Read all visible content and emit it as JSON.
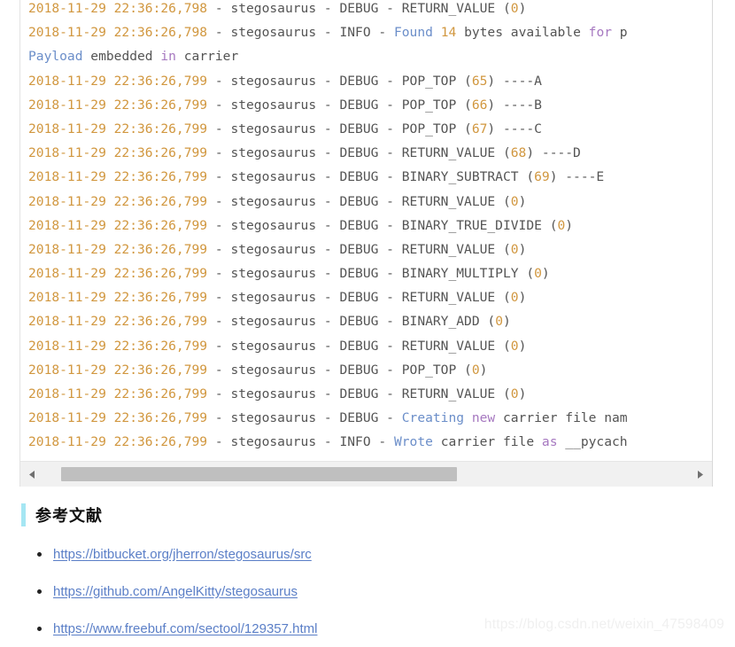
{
  "code_block": {
    "language": "log",
    "lines": [
      [
        {
          "t": "2018-11-29 22:36:26,798",
          "c": "time"
        },
        {
          "t": " - stegosaurus - DEBUG - RETURN_VALUE ",
          "c": "plain"
        },
        {
          "t": "(",
          "c": "plain"
        },
        {
          "t": "0",
          "c": "num"
        },
        {
          "t": ")",
          "c": "plain"
        }
      ],
      [
        {
          "t": "2018-11-29 22:36:26,798",
          "c": "time"
        },
        {
          "t": " - stegosaurus - INFO - ",
          "c": "plain"
        },
        {
          "t": "Found",
          "c": "kw"
        },
        {
          "t": " ",
          "c": "plain"
        },
        {
          "t": "14",
          "c": "num"
        },
        {
          "t": " bytes available ",
          "c": "plain"
        },
        {
          "t": "for",
          "c": "op"
        },
        {
          "t": " p",
          "c": "plain"
        }
      ],
      [
        {
          "t": "Payload",
          "c": "kw"
        },
        {
          "t": " embedded ",
          "c": "plain"
        },
        {
          "t": "in",
          "c": "op"
        },
        {
          "t": " carrier",
          "c": "plain"
        }
      ],
      [
        {
          "t": "2018-11-29 22:36:26,799",
          "c": "time"
        },
        {
          "t": " - stegosaurus - DEBUG - POP_TOP ",
          "c": "plain"
        },
        {
          "t": "(",
          "c": "plain"
        },
        {
          "t": "65",
          "c": "num"
        },
        {
          "t": ") ----A",
          "c": "plain"
        }
      ],
      [
        {
          "t": "2018-11-29 22:36:26,799",
          "c": "time"
        },
        {
          "t": " - stegosaurus - DEBUG - POP_TOP ",
          "c": "plain"
        },
        {
          "t": "(",
          "c": "plain"
        },
        {
          "t": "66",
          "c": "num"
        },
        {
          "t": ") ----B",
          "c": "plain"
        }
      ],
      [
        {
          "t": "2018-11-29 22:36:26,799",
          "c": "time"
        },
        {
          "t": " - stegosaurus - DEBUG - POP_TOP ",
          "c": "plain"
        },
        {
          "t": "(",
          "c": "plain"
        },
        {
          "t": "67",
          "c": "num"
        },
        {
          "t": ") ----C",
          "c": "plain"
        }
      ],
      [
        {
          "t": "2018-11-29 22:36:26,799",
          "c": "time"
        },
        {
          "t": " - stegosaurus - DEBUG - RETURN_VALUE ",
          "c": "plain"
        },
        {
          "t": "(",
          "c": "plain"
        },
        {
          "t": "68",
          "c": "num"
        },
        {
          "t": ") ----D",
          "c": "plain"
        }
      ],
      [
        {
          "t": "2018-11-29 22:36:26,799",
          "c": "time"
        },
        {
          "t": " - stegosaurus - DEBUG - BINARY_SUBTRACT ",
          "c": "plain"
        },
        {
          "t": "(",
          "c": "plain"
        },
        {
          "t": "69",
          "c": "num"
        },
        {
          "t": ") ----E",
          "c": "plain"
        }
      ],
      [
        {
          "t": "2018-11-29 22:36:26,799",
          "c": "time"
        },
        {
          "t": " - stegosaurus - DEBUG - RETURN_VALUE ",
          "c": "plain"
        },
        {
          "t": "(",
          "c": "plain"
        },
        {
          "t": "0",
          "c": "num"
        },
        {
          "t": ")",
          "c": "plain"
        }
      ],
      [
        {
          "t": "2018-11-29 22:36:26,799",
          "c": "time"
        },
        {
          "t": " - stegosaurus - DEBUG - BINARY_TRUE_DIVIDE ",
          "c": "plain"
        },
        {
          "t": "(",
          "c": "plain"
        },
        {
          "t": "0",
          "c": "num"
        },
        {
          "t": ")",
          "c": "plain"
        }
      ],
      [
        {
          "t": "2018-11-29 22:36:26,799",
          "c": "time"
        },
        {
          "t": " - stegosaurus - DEBUG - RETURN_VALUE ",
          "c": "plain"
        },
        {
          "t": "(",
          "c": "plain"
        },
        {
          "t": "0",
          "c": "num"
        },
        {
          "t": ")",
          "c": "plain"
        }
      ],
      [
        {
          "t": "2018-11-29 22:36:26,799",
          "c": "time"
        },
        {
          "t": " - stegosaurus - DEBUG - BINARY_MULTIPLY ",
          "c": "plain"
        },
        {
          "t": "(",
          "c": "plain"
        },
        {
          "t": "0",
          "c": "num"
        },
        {
          "t": ")",
          "c": "plain"
        }
      ],
      [
        {
          "t": "2018-11-29 22:36:26,799",
          "c": "time"
        },
        {
          "t": " - stegosaurus - DEBUG - RETURN_VALUE ",
          "c": "plain"
        },
        {
          "t": "(",
          "c": "plain"
        },
        {
          "t": "0",
          "c": "num"
        },
        {
          "t": ")",
          "c": "plain"
        }
      ],
      [
        {
          "t": "2018-11-29 22:36:26,799",
          "c": "time"
        },
        {
          "t": " - stegosaurus - DEBUG - BINARY_ADD ",
          "c": "plain"
        },
        {
          "t": "(",
          "c": "plain"
        },
        {
          "t": "0",
          "c": "num"
        },
        {
          "t": ")",
          "c": "plain"
        }
      ],
      [
        {
          "t": "2018-11-29 22:36:26,799",
          "c": "time"
        },
        {
          "t": " - stegosaurus - DEBUG - RETURN_VALUE ",
          "c": "plain"
        },
        {
          "t": "(",
          "c": "plain"
        },
        {
          "t": "0",
          "c": "num"
        },
        {
          "t": ")",
          "c": "plain"
        }
      ],
      [
        {
          "t": "2018-11-29 22:36:26,799",
          "c": "time"
        },
        {
          "t": " - stegosaurus - DEBUG - POP_TOP ",
          "c": "plain"
        },
        {
          "t": "(",
          "c": "plain"
        },
        {
          "t": "0",
          "c": "num"
        },
        {
          "t": ")",
          "c": "plain"
        }
      ],
      [
        {
          "t": "2018-11-29 22:36:26,799",
          "c": "time"
        },
        {
          "t": " - stegosaurus - DEBUG - RETURN_VALUE ",
          "c": "plain"
        },
        {
          "t": "(",
          "c": "plain"
        },
        {
          "t": "0",
          "c": "num"
        },
        {
          "t": ")",
          "c": "plain"
        }
      ],
      [
        {
          "t": "2018-11-29 22:36:26,799",
          "c": "time"
        },
        {
          "t": " - stegosaurus - DEBUG - ",
          "c": "plain"
        },
        {
          "t": "Creating",
          "c": "kw"
        },
        {
          "t": " ",
          "c": "plain"
        },
        {
          "t": "new",
          "c": "op"
        },
        {
          "t": " carrier file nam",
          "c": "plain"
        }
      ],
      [
        {
          "t": "2018-11-29 22:36:26,799",
          "c": "time"
        },
        {
          "t": " - stegosaurus - INFO - ",
          "c": "plain"
        },
        {
          "t": "Wrote",
          "c": "kw"
        },
        {
          "t": " carrier file ",
          "c": "plain"
        },
        {
          "t": "as",
          "c": "op"
        },
        {
          "t": " __pycach",
          "c": "plain"
        }
      ]
    ],
    "scrollbar": {
      "left_arrow_icon": "triangle-left-icon",
      "right_arrow_icon": "triangle-right-icon",
      "thumb_position_percent": 3,
      "thumb_width_percent": 61
    }
  },
  "references_section": {
    "heading": "参考文献",
    "accent_color": "#a5e6f3",
    "links": [
      "https://bitbucket.org/jherron/stegosaurus/src",
      "https://github.com/AngelKitty/stegosaurus",
      "https://www.freebuf.com/sectool/129357.html"
    ]
  },
  "watermark": {
    "text": "https://blog.csdn.net/weixin_47598409"
  }
}
